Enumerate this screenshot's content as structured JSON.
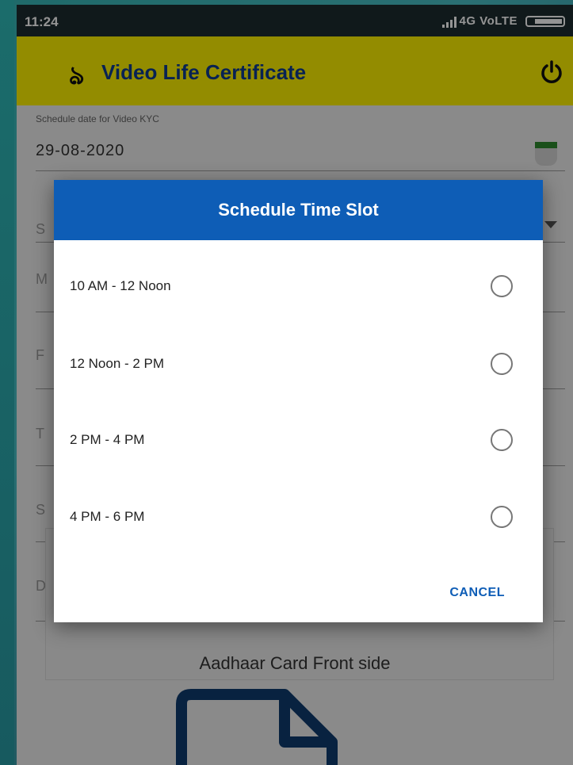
{
  "status_bar": {
    "time": "11:24",
    "network": "4G VoLTE"
  },
  "app_bar": {
    "logo_glyph": "ঌ",
    "title": "Video Life Certificate",
    "power_icon": "power-icon"
  },
  "form": {
    "schedule_date_label": "Schedule date for Video KYC",
    "schedule_date_value": "29-08-2020",
    "cutoff_letters": [
      "S",
      "M",
      "F",
      "T",
      "S",
      "D"
    ],
    "upload_label": "Aadhaar Card Front side"
  },
  "dialog": {
    "title": "Schedule Time Slot",
    "slots": [
      {
        "label": "10 AM - 12 Noon",
        "selected": false
      },
      {
        "label": "12 Noon - 2 PM",
        "selected": false
      },
      {
        "label": "2 PM - 4 PM",
        "selected": false
      },
      {
        "label": "4 PM - 6 PM",
        "selected": false
      }
    ],
    "cancel_label": "CANCEL"
  },
  "colors": {
    "app_bar": "#fef200",
    "title_blue": "#0f3b8f",
    "dialog_header": "#0e5db6",
    "status_bar": "#1d2b2f"
  }
}
